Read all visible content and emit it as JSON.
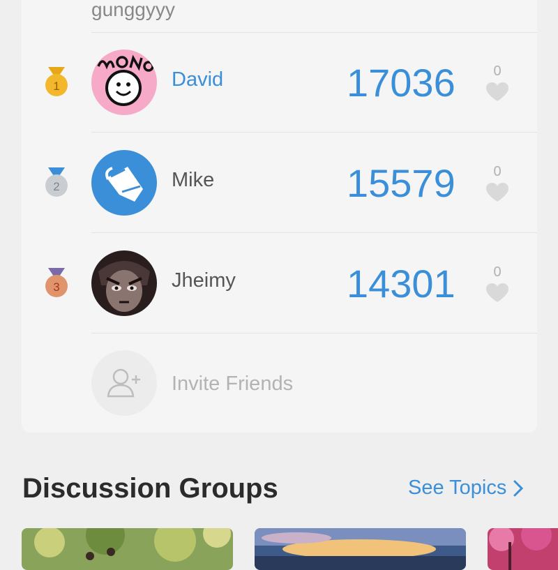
{
  "leaderboard": {
    "previous_row_name": "gunggyyy",
    "rows": [
      {
        "rank": "1",
        "name": "David",
        "score": "17036",
        "likes": "0",
        "medal_color": "#f2b72a",
        "ribbon_color": "#e6a817",
        "avatar": "mono-face-avatar"
      },
      {
        "rank": "2",
        "name": "Mike",
        "score": "15579",
        "likes": "0",
        "medal_color": "#c9cdd2",
        "ribbon_color": "#3a8fd8",
        "avatar": "mask-avatar"
      },
      {
        "rank": "3",
        "name": "Jheimy",
        "score": "14301",
        "likes": "0",
        "medal_color": "#e0946b",
        "ribbon_color": "#7a6aa8",
        "avatar": "anime-face-avatar"
      }
    ],
    "invite_label": "Invite Friends"
  },
  "discussion": {
    "title": "Discussion Groups",
    "see_topics_label": "See Topics"
  },
  "colors": {
    "accent": "#3a8fd8",
    "background": "#efefef",
    "card": "#f5f5f5"
  }
}
